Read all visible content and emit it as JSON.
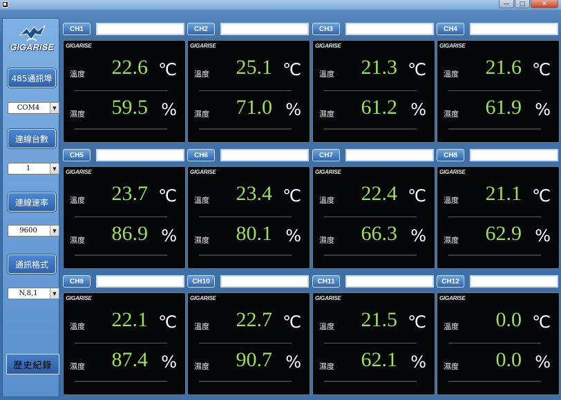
{
  "logo": {
    "brand": "GIGARISE"
  },
  "sidebar": {
    "port_button": "485通訊埠",
    "port_value": "COM4",
    "count_button": "連線台數",
    "count_value": "1",
    "baud_button": "連線速率",
    "baud_value": "9600",
    "format_button": "通訊格式",
    "format_value": "N,8,1",
    "history_button": "歷史紀錄"
  },
  "labels": {
    "temp": "溫度",
    "hum": "濕度",
    "temp_unit": "℃",
    "hum_unit": "%"
  },
  "channels": [
    {
      "label": "CH1",
      "temp": "22.6",
      "hum": "59.5"
    },
    {
      "label": "CH2",
      "temp": "25.1",
      "hum": "71.0"
    },
    {
      "label": "CH3",
      "temp": "21.3",
      "hum": "61.2"
    },
    {
      "label": "CH4",
      "temp": "21.6",
      "hum": "61.9"
    },
    {
      "label": "CH5",
      "temp": "23.7",
      "hum": "86.9"
    },
    {
      "label": "CH6",
      "temp": "23.4",
      "hum": "80.1"
    },
    {
      "label": "CH7",
      "temp": "22.4",
      "hum": "66.3"
    },
    {
      "label": "CH8",
      "temp": "21.1",
      "hum": "62.9"
    },
    {
      "label": "CH9",
      "temp": "22.1",
      "hum": "87.4"
    },
    {
      "label": "CH10",
      "temp": "22.7",
      "hum": "90.7"
    },
    {
      "label": "CH11",
      "temp": "21.5",
      "hum": "62.1"
    },
    {
      "label": "CH12",
      "temp": "0.0",
      "hum": "0.0"
    }
  ],
  "colors": {
    "value_green": "#9ee05a",
    "panel_bg": "#050608",
    "window_blue": "#3e6fa6"
  }
}
